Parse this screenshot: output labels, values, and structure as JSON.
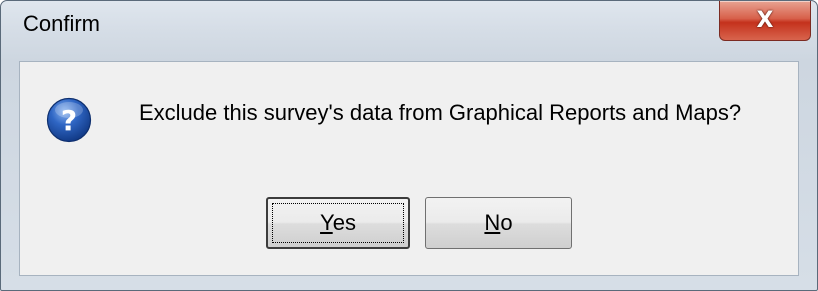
{
  "window": {
    "title": "Confirm",
    "close_glyph": "X"
  },
  "dialog": {
    "icon": "question-icon",
    "message": "Exclude this survey's data from Graphical Reports and Maps?",
    "buttons": {
      "yes": {
        "mnemonic": "Y",
        "rest": "es"
      },
      "no": {
        "mnemonic": "N",
        "rest": "o"
      }
    }
  },
  "colors": {
    "close_button": "#c4311c",
    "icon_blue": "#1c4fa8",
    "client_bg": "#f0f0f0"
  }
}
